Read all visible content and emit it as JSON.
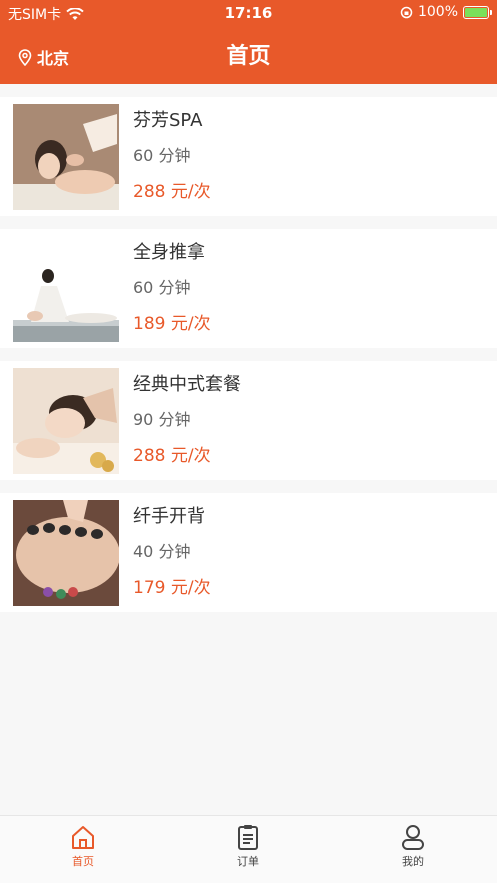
{
  "status_bar": {
    "carrier": "无SIM卡",
    "time": "17:16",
    "battery": "100%"
  },
  "nav": {
    "title": "首页",
    "location": "北京"
  },
  "colors": {
    "accent": "#e8592a",
    "background": "#f7f7f7",
    "battery": "#7ae05a"
  },
  "services": [
    {
      "name": "芬芳SPA",
      "duration": "60 分钟",
      "price": "288 元/次"
    },
    {
      "name": "全身推拿",
      "duration": "60 分钟",
      "price": "189 元/次"
    },
    {
      "name": "经典中式套餐",
      "duration": "90 分钟",
      "price": "288 元/次"
    },
    {
      "name": "纤手开背",
      "duration": "40 分钟",
      "price": "179 元/次"
    }
  ],
  "tabbar": [
    {
      "label": "首页",
      "icon": "home-icon",
      "active": true
    },
    {
      "label": "订单",
      "icon": "order-list-icon",
      "active": false
    },
    {
      "label": "我的",
      "icon": "profile-icon",
      "active": false
    }
  ]
}
